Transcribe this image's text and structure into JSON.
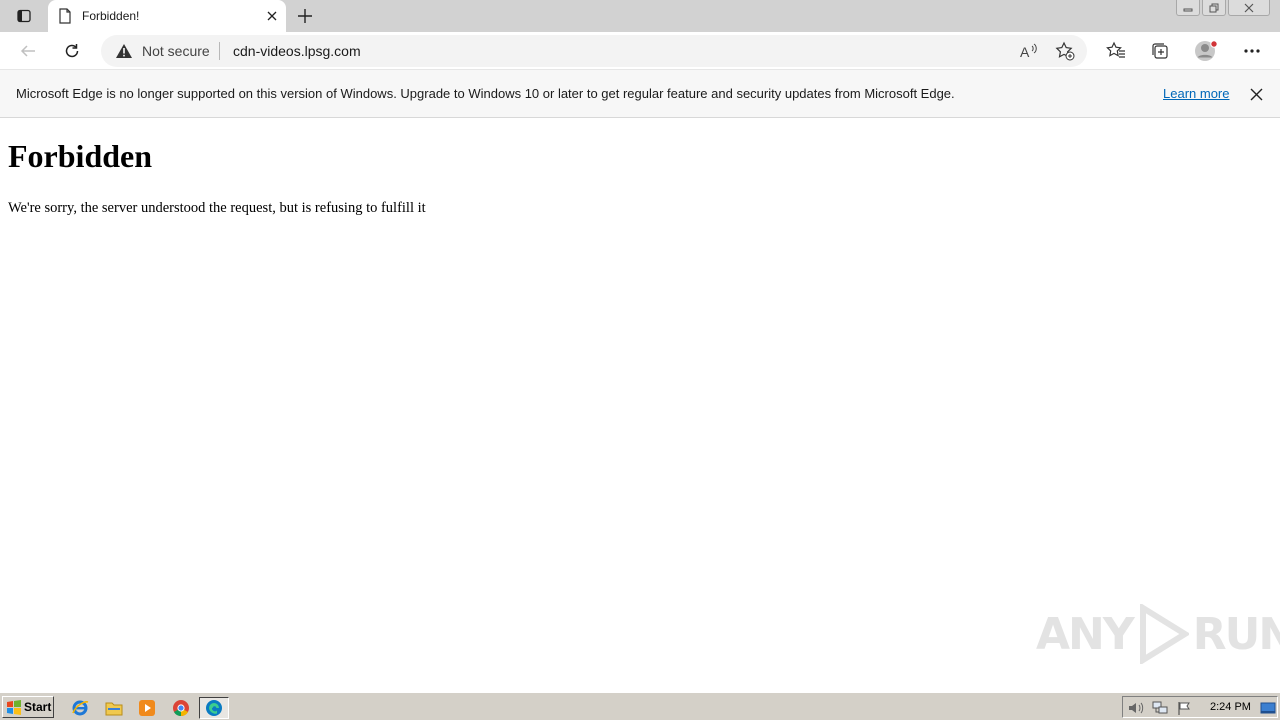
{
  "browser": {
    "tab": {
      "title": "Forbidden!"
    },
    "address": {
      "security_label": "Not secure",
      "url": "cdn-videos.lpsg.com"
    }
  },
  "infobar": {
    "message": "Microsoft Edge is no longer supported on this version of Windows. Upgrade to Windows 10 or later to get regular feature and security updates from Microsoft Edge.",
    "link": "Learn more"
  },
  "page": {
    "heading": "Forbidden",
    "message": "We're sorry, the server understood the request, but is refusing to fulfill it"
  },
  "watermark": {
    "left": "ANY",
    "right": "RUN"
  },
  "taskbar": {
    "start_label": "Start",
    "apps": [
      "internet-explorer-icon",
      "folder-icon",
      "media-player-icon",
      "chrome-icon",
      "edge-icon"
    ],
    "clock": "2:24 PM"
  },
  "colors": {
    "link": "#0067b8",
    "notification_dot": "#d13438",
    "taskbar": "#d4d0c8"
  }
}
